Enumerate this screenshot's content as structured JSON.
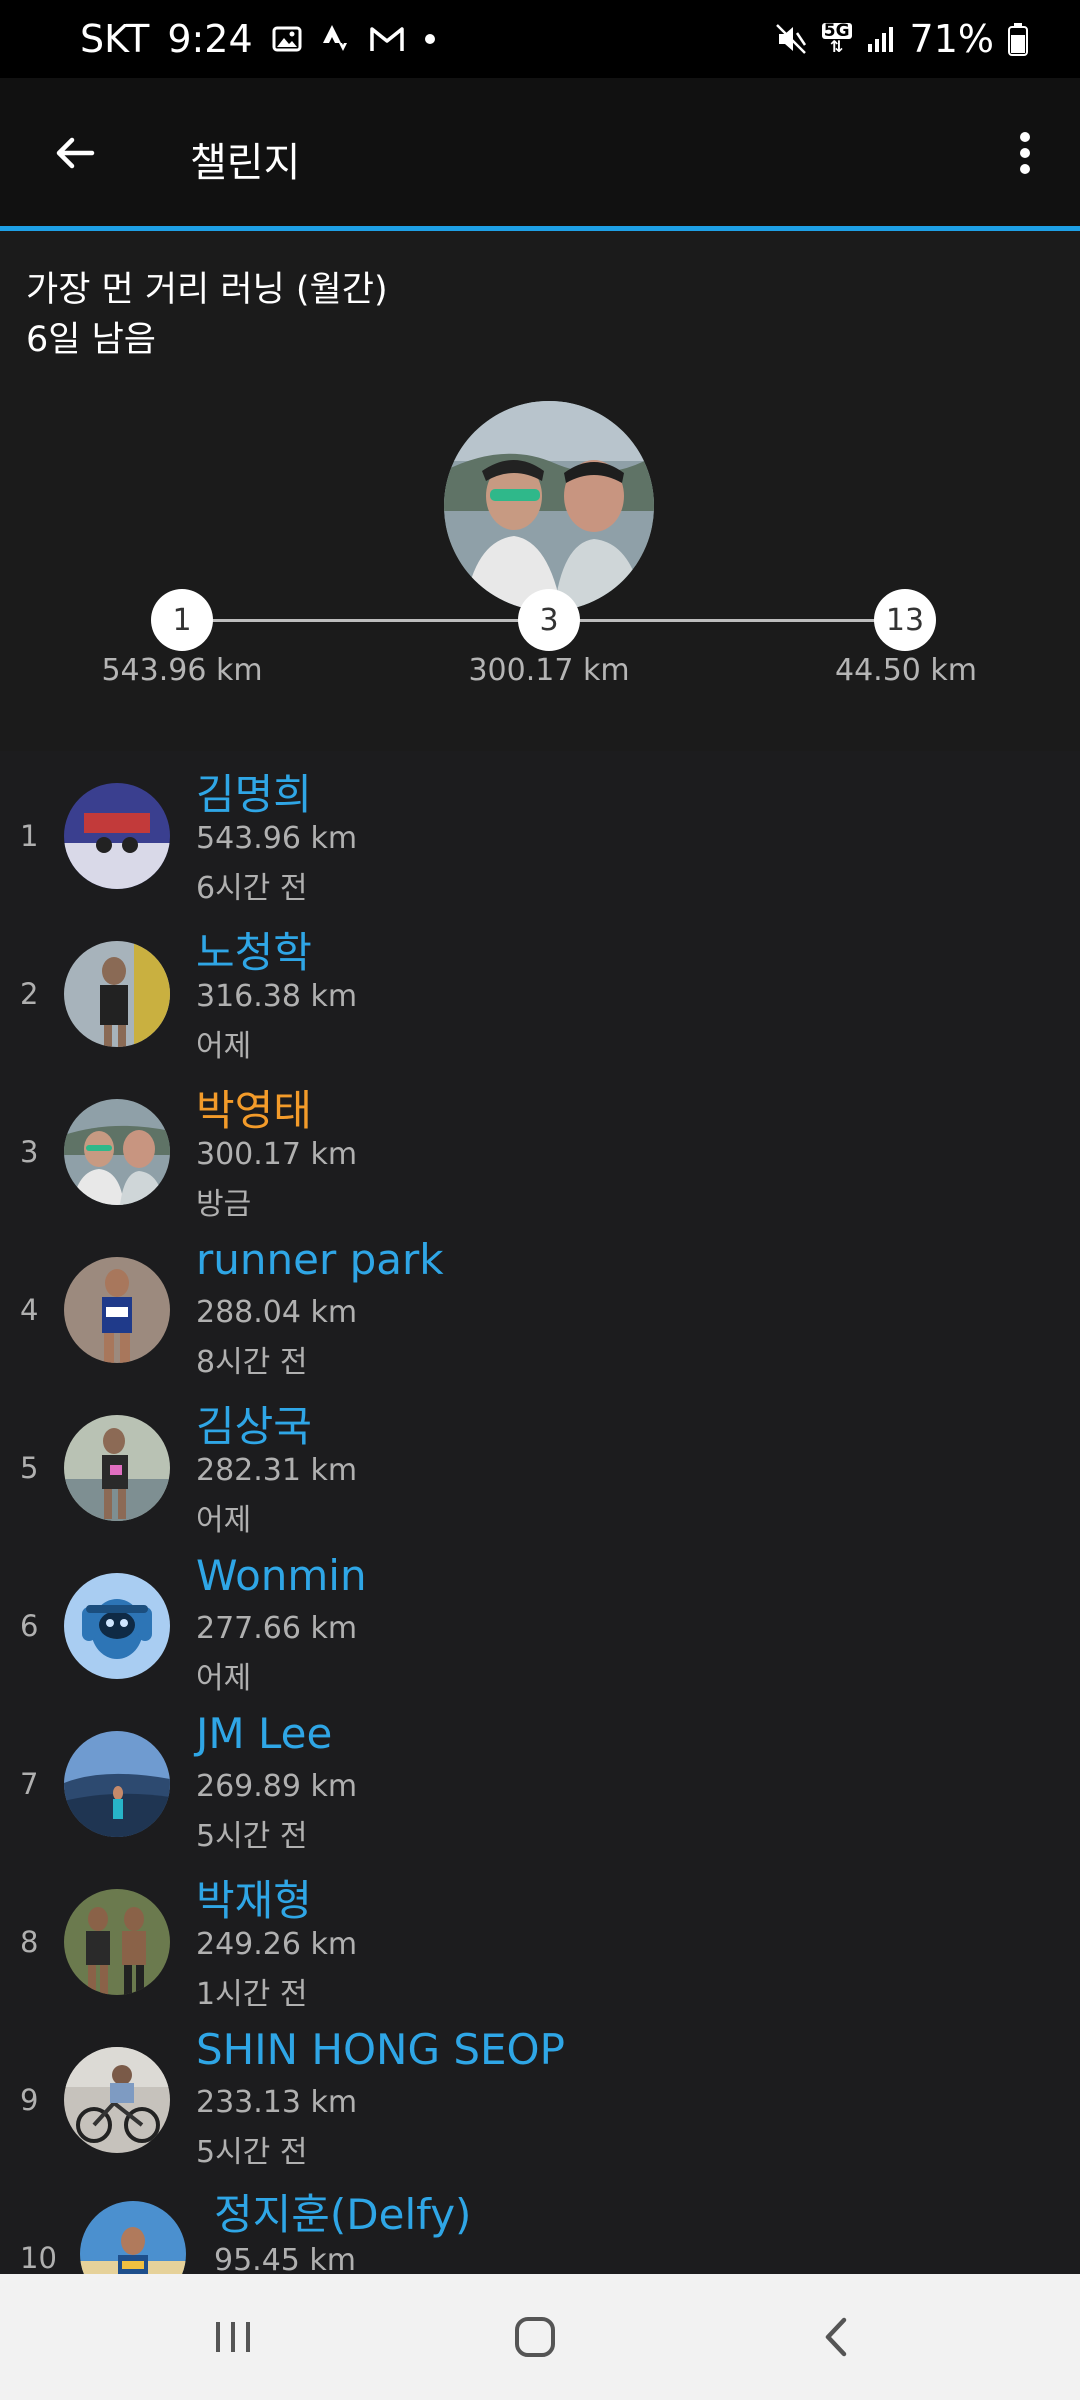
{
  "status_bar": {
    "carrier": "SKT",
    "time": "9:24",
    "battery": "71%",
    "network": "5G"
  },
  "app_bar": {
    "title": "챌린지",
    "back_icon": "arrow-left-icon",
    "menu_icon": "more-vertical-icon"
  },
  "accent_color": "#1ea0e6",
  "challenge": {
    "name": "가장 먼 거리 러닝 (월간)",
    "days_left": "6일 남음",
    "progress": [
      {
        "rank": "1",
        "distance": "543.96 km"
      },
      {
        "rank": "3",
        "distance": "300.17 km"
      },
      {
        "rank": "13",
        "distance": "44.50 km"
      }
    ]
  },
  "leaderboard": [
    {
      "rank": "1",
      "name": "김명희",
      "distance": "543.96 km",
      "when": "6시간 전"
    },
    {
      "rank": "2",
      "name": "노청학",
      "distance": "316.38 km",
      "when": "어제"
    },
    {
      "rank": "3",
      "name": "박영태",
      "distance": "300.17 km",
      "when": "방금"
    },
    {
      "rank": "4",
      "name": "runner park",
      "distance": "288.04 km",
      "when": "8시간 전"
    },
    {
      "rank": "5",
      "name": "김상국",
      "distance": "282.31 km",
      "when": "어제"
    },
    {
      "rank": "6",
      "name": "Wonmin",
      "distance": "277.66 km",
      "when": "어제"
    },
    {
      "rank": "7",
      "name": "JM Lee",
      "distance": "269.89 km",
      "when": "5시간 전"
    },
    {
      "rank": "8",
      "name": "박재형",
      "distance": "249.26 km",
      "when": "1시간 전"
    },
    {
      "rank": "9",
      "name": "SHIN HONG SEOP",
      "distance": "233.13 km",
      "when": "5시간 전"
    },
    {
      "rank": "10",
      "name": "정지훈(Delfy)",
      "distance": "95.45 km",
      "when": ""
    }
  ],
  "nav_bar": {
    "recents_icon": "recents-icon",
    "home_icon": "home-icon",
    "back_icon": "back-chevron-icon"
  }
}
